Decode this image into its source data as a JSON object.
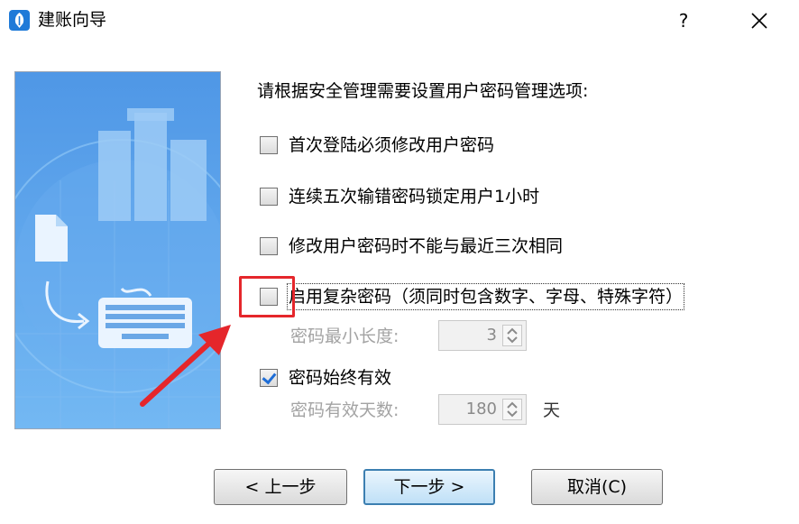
{
  "window": {
    "title": "建账向导",
    "help_label": "?"
  },
  "content": {
    "prompt": "请根据安全管理需要设置用户密码管理选项:"
  },
  "options": [
    {
      "label": "首次登陆必须修改用户密码",
      "checked": false
    },
    {
      "label": "连续五次输错密码锁定用户1小时",
      "checked": false
    },
    {
      "label": "修改用户密码时不能与最近三次相同",
      "checked": false
    },
    {
      "label": "启用复杂密码（须同时包含数字、字母、特殊字符）",
      "checked": false
    },
    {
      "label": "密码始终有效",
      "checked": true
    }
  ],
  "min_length": {
    "label": "密码最小长度:",
    "value": "3"
  },
  "valid_days": {
    "label": "密码有效天数:",
    "value": "180",
    "unit": "天"
  },
  "buttons": {
    "back": "< 上一步",
    "next": "下一步 >",
    "cancel": "取消(C)"
  },
  "colors": {
    "accent": "#3c7fb1",
    "annotation_red": "#e5262b",
    "illustration_blue": "#5aa2ea"
  }
}
